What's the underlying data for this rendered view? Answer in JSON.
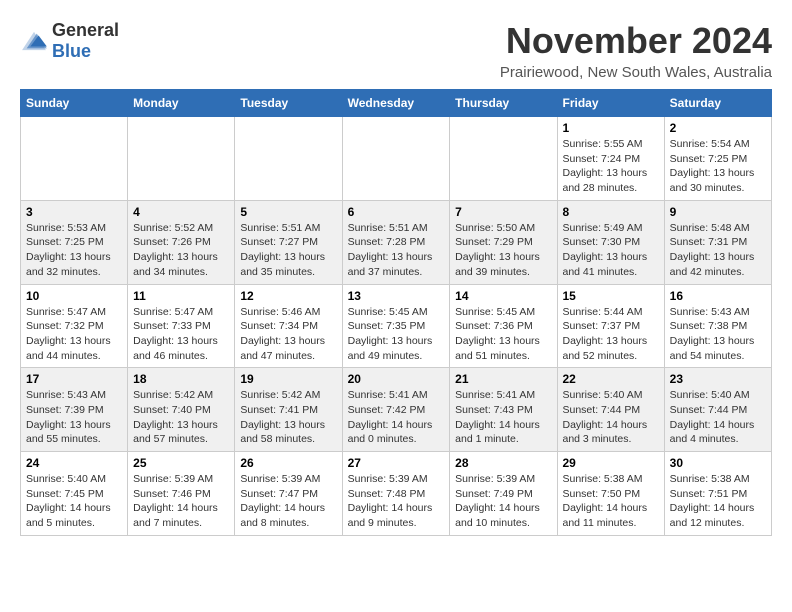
{
  "logo": {
    "general": "General",
    "blue": "Blue"
  },
  "title": "November 2024",
  "location": "Prairiewood, New South Wales, Australia",
  "weekdays": [
    "Sunday",
    "Monday",
    "Tuesday",
    "Wednesday",
    "Thursday",
    "Friday",
    "Saturday"
  ],
  "weeks": [
    [
      {
        "day": "",
        "info": ""
      },
      {
        "day": "",
        "info": ""
      },
      {
        "day": "",
        "info": ""
      },
      {
        "day": "",
        "info": ""
      },
      {
        "day": "",
        "info": ""
      },
      {
        "day": "1",
        "info": "Sunrise: 5:55 AM\nSunset: 7:24 PM\nDaylight: 13 hours\nand 28 minutes."
      },
      {
        "day": "2",
        "info": "Sunrise: 5:54 AM\nSunset: 7:25 PM\nDaylight: 13 hours\nand 30 minutes."
      }
    ],
    [
      {
        "day": "3",
        "info": "Sunrise: 5:53 AM\nSunset: 7:25 PM\nDaylight: 13 hours\nand 32 minutes."
      },
      {
        "day": "4",
        "info": "Sunrise: 5:52 AM\nSunset: 7:26 PM\nDaylight: 13 hours\nand 34 minutes."
      },
      {
        "day": "5",
        "info": "Sunrise: 5:51 AM\nSunset: 7:27 PM\nDaylight: 13 hours\nand 35 minutes."
      },
      {
        "day": "6",
        "info": "Sunrise: 5:51 AM\nSunset: 7:28 PM\nDaylight: 13 hours\nand 37 minutes."
      },
      {
        "day": "7",
        "info": "Sunrise: 5:50 AM\nSunset: 7:29 PM\nDaylight: 13 hours\nand 39 minutes."
      },
      {
        "day": "8",
        "info": "Sunrise: 5:49 AM\nSunset: 7:30 PM\nDaylight: 13 hours\nand 41 minutes."
      },
      {
        "day": "9",
        "info": "Sunrise: 5:48 AM\nSunset: 7:31 PM\nDaylight: 13 hours\nand 42 minutes."
      }
    ],
    [
      {
        "day": "10",
        "info": "Sunrise: 5:47 AM\nSunset: 7:32 PM\nDaylight: 13 hours\nand 44 minutes."
      },
      {
        "day": "11",
        "info": "Sunrise: 5:47 AM\nSunset: 7:33 PM\nDaylight: 13 hours\nand 46 minutes."
      },
      {
        "day": "12",
        "info": "Sunrise: 5:46 AM\nSunset: 7:34 PM\nDaylight: 13 hours\nand 47 minutes."
      },
      {
        "day": "13",
        "info": "Sunrise: 5:45 AM\nSunset: 7:35 PM\nDaylight: 13 hours\nand 49 minutes."
      },
      {
        "day": "14",
        "info": "Sunrise: 5:45 AM\nSunset: 7:36 PM\nDaylight: 13 hours\nand 51 minutes."
      },
      {
        "day": "15",
        "info": "Sunrise: 5:44 AM\nSunset: 7:37 PM\nDaylight: 13 hours\nand 52 minutes."
      },
      {
        "day": "16",
        "info": "Sunrise: 5:43 AM\nSunset: 7:38 PM\nDaylight: 13 hours\nand 54 minutes."
      }
    ],
    [
      {
        "day": "17",
        "info": "Sunrise: 5:43 AM\nSunset: 7:39 PM\nDaylight: 13 hours\nand 55 minutes."
      },
      {
        "day": "18",
        "info": "Sunrise: 5:42 AM\nSunset: 7:40 PM\nDaylight: 13 hours\nand 57 minutes."
      },
      {
        "day": "19",
        "info": "Sunrise: 5:42 AM\nSunset: 7:41 PM\nDaylight: 13 hours\nand 58 minutes."
      },
      {
        "day": "20",
        "info": "Sunrise: 5:41 AM\nSunset: 7:42 PM\nDaylight: 14 hours\nand 0 minutes."
      },
      {
        "day": "21",
        "info": "Sunrise: 5:41 AM\nSunset: 7:43 PM\nDaylight: 14 hours\nand 1 minute."
      },
      {
        "day": "22",
        "info": "Sunrise: 5:40 AM\nSunset: 7:44 PM\nDaylight: 14 hours\nand 3 minutes."
      },
      {
        "day": "23",
        "info": "Sunrise: 5:40 AM\nSunset: 7:44 PM\nDaylight: 14 hours\nand 4 minutes."
      }
    ],
    [
      {
        "day": "24",
        "info": "Sunrise: 5:40 AM\nSunset: 7:45 PM\nDaylight: 14 hours\nand 5 minutes."
      },
      {
        "day": "25",
        "info": "Sunrise: 5:39 AM\nSunset: 7:46 PM\nDaylight: 14 hours\nand 7 minutes."
      },
      {
        "day": "26",
        "info": "Sunrise: 5:39 AM\nSunset: 7:47 PM\nDaylight: 14 hours\nand 8 minutes."
      },
      {
        "day": "27",
        "info": "Sunrise: 5:39 AM\nSunset: 7:48 PM\nDaylight: 14 hours\nand 9 minutes."
      },
      {
        "day": "28",
        "info": "Sunrise: 5:39 AM\nSunset: 7:49 PM\nDaylight: 14 hours\nand 10 minutes."
      },
      {
        "day": "29",
        "info": "Sunrise: 5:38 AM\nSunset: 7:50 PM\nDaylight: 14 hours\nand 11 minutes."
      },
      {
        "day": "30",
        "info": "Sunrise: 5:38 AM\nSunset: 7:51 PM\nDaylight: 14 hours\nand 12 minutes."
      }
    ]
  ]
}
